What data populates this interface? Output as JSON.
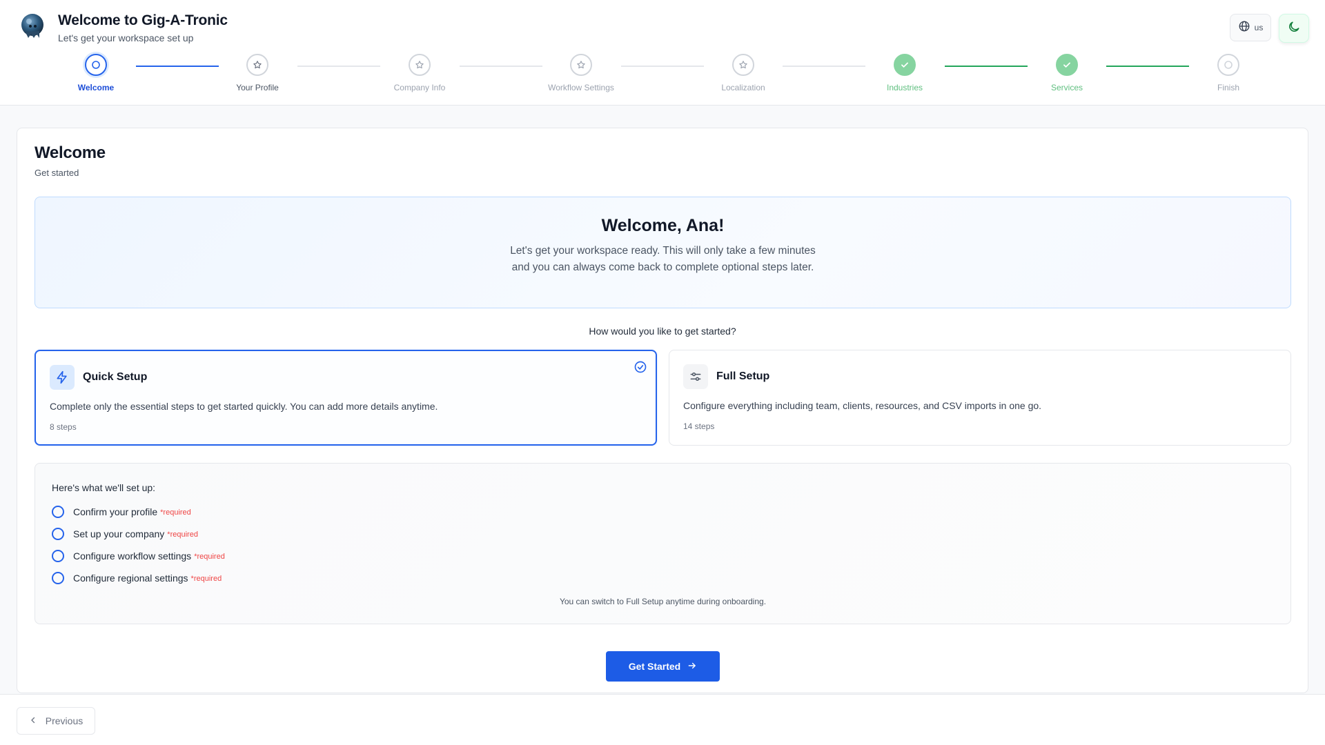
{
  "header": {
    "title": "Welcome to Gig-A-Tronic",
    "subtitle": "Let's get your workspace set up",
    "language_label": "us",
    "language_icon": "globe-icon",
    "theme_icon": "moon-icon"
  },
  "stepper": {
    "steps": [
      {
        "label": "Welcome",
        "state": "active"
      },
      {
        "label": "Your Profile",
        "state": "upcoming"
      },
      {
        "label": "Company Info",
        "state": "upcoming"
      },
      {
        "label": "Workflow Settings",
        "state": "upcoming"
      },
      {
        "label": "Localization",
        "state": "upcoming"
      },
      {
        "label": "Industries",
        "state": "completed"
      },
      {
        "label": "Services",
        "state": "completed"
      },
      {
        "label": "Finish",
        "state": "upcoming"
      }
    ]
  },
  "card": {
    "title": "Welcome",
    "subtitle": "Get started",
    "hero": {
      "title": "Welcome, Ana!",
      "text": "Let's get your workspace ready. This will only take a few minutes and you can always come back to complete optional steps later."
    },
    "question": "How would you like to get started?",
    "options": [
      {
        "title": "Quick Setup",
        "description": "Complete only the essential steps to get started quickly. You can add more details anytime.",
        "steps": "8 steps",
        "selected": true,
        "icon": "lightning-icon"
      },
      {
        "title": "Full Setup",
        "description": "Configure everything including team, clients, resources, and CSV imports in one go.",
        "steps": "14 steps",
        "selected": false,
        "icon": "sliders-icon"
      }
    ],
    "setup": {
      "heading": "Here's what we'll set up:",
      "tasks": [
        {
          "label": "Confirm your profile",
          "required": "*required"
        },
        {
          "label": "Set up your company",
          "required": "*required"
        },
        {
          "label": "Configure workflow settings",
          "required": "*required"
        },
        {
          "label": "Configure regional settings",
          "required": "*required"
        }
      ],
      "note": "You can switch to Full Setup anytime during onboarding."
    },
    "cta": "Get Started"
  },
  "footer": {
    "previous": "Previous"
  },
  "colors": {
    "accent": "#2563eb",
    "success": "#22a55a",
    "required": "#ef4444"
  }
}
